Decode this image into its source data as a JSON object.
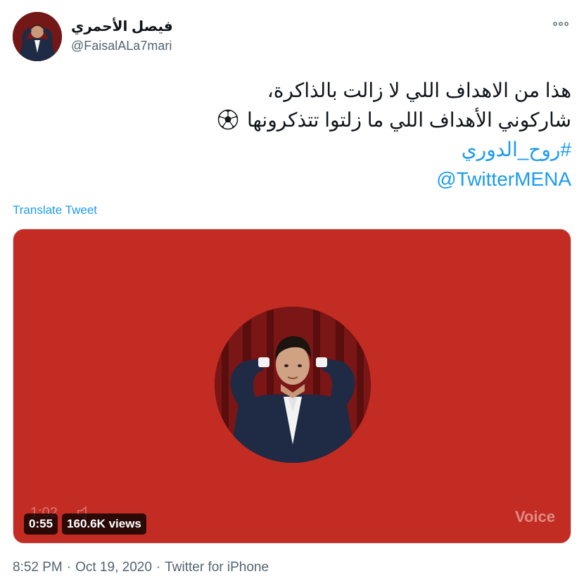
{
  "author": {
    "display_name": "فيصل الأحمري",
    "handle": "@FaisalALa7mari",
    "avatar_icon": "avatar-photo"
  },
  "more_icon": "more-options-icon",
  "tweet": {
    "line1": "هذا من الاهداف اللي لا زالت بالذاكرة،",
    "line2": "شاركوني الأهداف اللي ما زلتوا تتذكرونها",
    "line2_emoji": "soccer-ball-icon",
    "hashtag": "#روح_الدوري",
    "mention": "@TwitterMENA"
  },
  "translate_label": "Translate Tweet",
  "media": {
    "background_color": "#c32c22",
    "ghost_time": "1:02",
    "duration": "0:55",
    "views": "160.6K views",
    "watermark": "Voice"
  },
  "footer": {
    "time": "8:52 PM",
    "separator": "·",
    "date": "Oct 19, 2020",
    "source": "Twitter for iPhone"
  },
  "colors": {
    "link": "#1d9bf0",
    "secondary_text": "#536471",
    "media_red": "#c32c22"
  }
}
